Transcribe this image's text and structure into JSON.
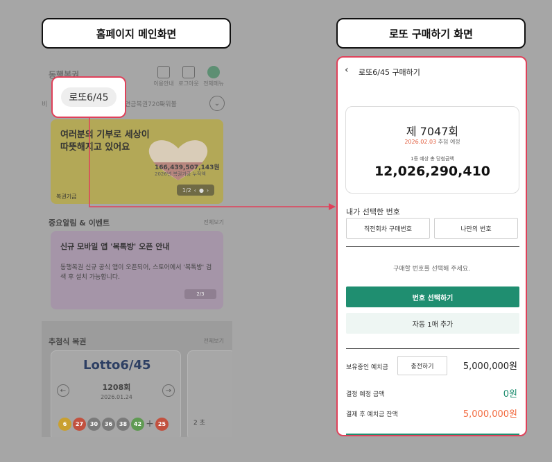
{
  "left_header": "홈페이지 메인화면",
  "right_header": "로또 구매하기 화면",
  "left_phone": {
    "logo": "동행복권",
    "top_icons": [
      {
        "label": "이용안내",
        "icon": "book-icon"
      },
      {
        "label": "로그아웃",
        "icon": "logout-icon"
      },
      {
        "label": "전체메뉴",
        "icon": "menu-icon"
      }
    ],
    "tabs": [
      "연금복권720+",
      "파워볼"
    ],
    "tab_prefix": "비",
    "chip_label": "로또6/45",
    "banner": {
      "title": "여러분의 기부로 세상이\n따뜻해지고 있어요",
      "amount": "166,439,507,143원",
      "amount_sub": "2026년 복권기금 누적액",
      "foot": "복권기금",
      "pager": "1/2"
    },
    "notice_section": {
      "title": "중요알림 & 이벤트",
      "see_all": "전체보기"
    },
    "notice": {
      "title": "신규 모바일 앱 '복톡방' 오픈 안내",
      "body": "동행복권 신규 공식 앱이 오픈되어, 스토어에서 '복톡방' 검색 후 설치 가능합니다.",
      "pager": "2/3"
    },
    "draw_section": {
      "title": "추첨식 복권",
      "see_all": "전체보기"
    },
    "lotto": {
      "logo": "Lotto6/45",
      "round": "1208회",
      "date": "2026.01.24",
      "balls": [
        {
          "n": "6",
          "color": "#c9a030"
        },
        {
          "n": "27",
          "color": "#c2513f"
        },
        {
          "n": "30",
          "color": "#7a7a7a"
        },
        {
          "n": "36",
          "color": "#7a7a7a"
        },
        {
          "n": "38",
          "color": "#7a7a7a"
        },
        {
          "n": "42",
          "color": "#5f9a52"
        }
      ],
      "bonus": {
        "n": "25",
        "color": "#c2513f"
      }
    },
    "card2_text": "2 초"
  },
  "right_phone": {
    "title": "로또6/45 구매하기",
    "round": "제 7047회",
    "draw_date": "2026.02.03",
    "draw_date_suffix": "추첨 예정",
    "prize_label": "1등 예상 총 당첨금액",
    "prize": "12,026,290,410",
    "selected_label": "내가 선택한 번호",
    "btn_last_round": "직전회차 구매번호",
    "btn_my_numbers": "나만의 번호",
    "hint": "구매할 번호를 선택해 주세요.",
    "btn_select": "번호 선택하기",
    "btn_auto": "자동 1매 추가",
    "balance_label": "보유중인 예치금",
    "charge_button": "충전하기",
    "balance_value": "5,000,000원",
    "pay_label": "결정 예정 금액",
    "pay_value": "0원",
    "after_label": "결제 후 예치금 잔액",
    "after_value": "5,000,000원",
    "colors": {
      "accent": "#1f8e70",
      "highlight": "#e0415a",
      "orange": "#f26a3f"
    }
  }
}
